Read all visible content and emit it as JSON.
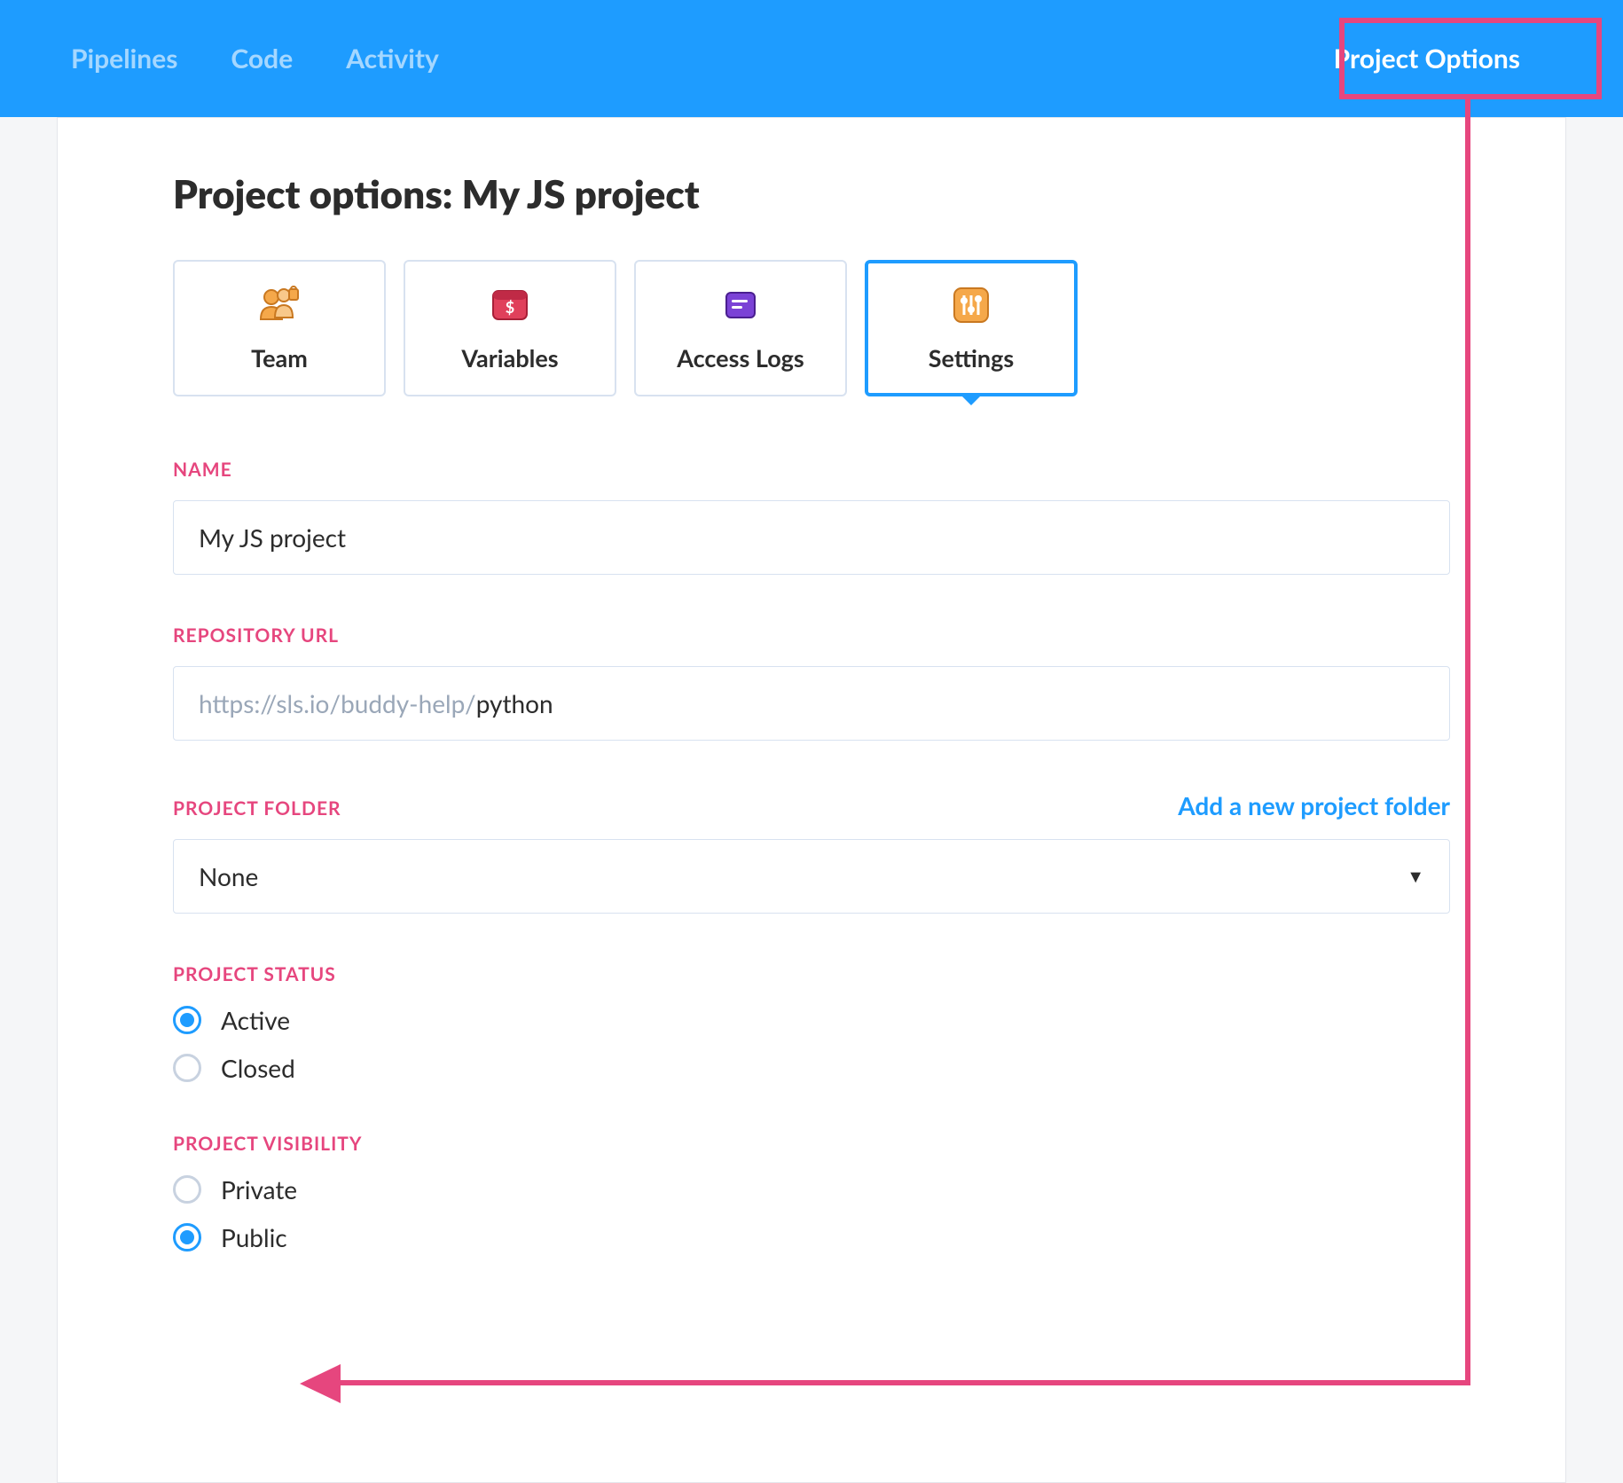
{
  "topbar": {
    "links": [
      "Pipelines",
      "Code",
      "Activity"
    ],
    "right_button": "Project Options"
  },
  "page": {
    "title": "Project options: My JS project"
  },
  "tabs": [
    {
      "label": "Team"
    },
    {
      "label": "Variables"
    },
    {
      "label": "Access Logs"
    },
    {
      "label": "Settings"
    }
  ],
  "sections": {
    "name": {
      "label": "NAME",
      "value": "My JS project"
    },
    "repo": {
      "label": "REPOSITORY URL",
      "prefix": "https://sls.io/buddy-help/",
      "value": "python"
    },
    "folder": {
      "label": "PROJECT FOLDER",
      "action": "Add a new project folder",
      "value": "None"
    },
    "status": {
      "label": "PROJECT STATUS",
      "options": [
        "Active",
        "Closed"
      ],
      "selected": "Active"
    },
    "visibility": {
      "label": "PROJECT VISIBILITY",
      "options": [
        "Private",
        "Public"
      ],
      "selected": "Public"
    }
  }
}
